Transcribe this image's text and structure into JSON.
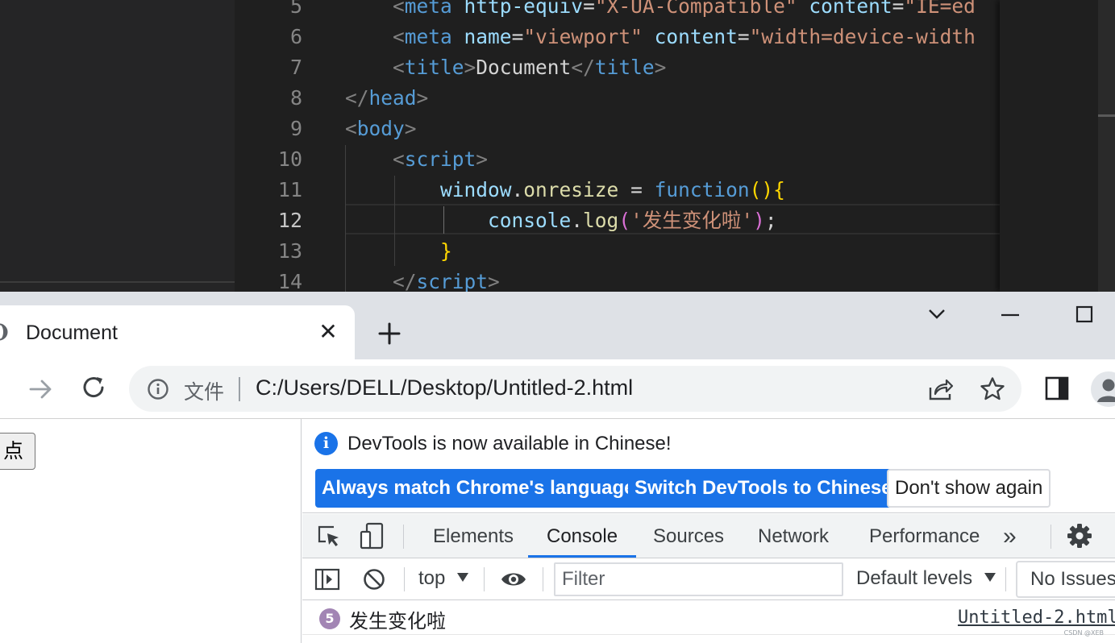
{
  "editor": {
    "line_numbers": [
      "5",
      "6",
      "7",
      "8",
      "9",
      "10",
      "11",
      "12",
      "13",
      "14"
    ],
    "active_line": "12",
    "lines": [
      [
        [
          "punc",
          "    <"
        ],
        [
          "tag",
          "meta"
        ],
        [
          "text",
          " "
        ],
        [
          "attr",
          "http-equiv"
        ],
        [
          "text",
          "="
        ],
        [
          "str",
          "\"X-UA-Compatible\""
        ],
        [
          "text",
          " "
        ],
        [
          "attr",
          "content"
        ],
        [
          "text",
          "="
        ],
        [
          "str",
          "\"IE=ed"
        ]
      ],
      [
        [
          "punc",
          "    <"
        ],
        [
          "tag",
          "meta"
        ],
        [
          "text",
          " "
        ],
        [
          "attr",
          "name"
        ],
        [
          "text",
          "="
        ],
        [
          "str",
          "\"viewport\""
        ],
        [
          "text",
          " "
        ],
        [
          "attr",
          "content"
        ],
        [
          "text",
          "="
        ],
        [
          "str",
          "\"width=device-width"
        ]
      ],
      [
        [
          "punc",
          "    <"
        ],
        [
          "tag",
          "title"
        ],
        [
          "punc",
          ">"
        ],
        [
          "text",
          "Document"
        ],
        [
          "punc",
          "</"
        ],
        [
          "tag",
          "title"
        ],
        [
          "punc",
          ">"
        ]
      ],
      [
        [
          "punc",
          "</"
        ],
        [
          "tag",
          "head"
        ],
        [
          "punc",
          ">"
        ]
      ],
      [
        [
          "punc",
          "<"
        ],
        [
          "tag",
          "body"
        ],
        [
          "punc",
          ">"
        ]
      ],
      [
        [
          "punc",
          "    <"
        ],
        [
          "tag",
          "script"
        ],
        [
          "punc",
          ">"
        ]
      ],
      [
        [
          "text",
          "        "
        ],
        [
          "var",
          "window"
        ],
        [
          "text",
          "."
        ],
        [
          "fn",
          "onresize"
        ],
        [
          "text",
          " = "
        ],
        [
          "kw",
          "function"
        ],
        [
          "brace1",
          "()"
        ],
        [
          "brace1",
          "{"
        ]
      ],
      [
        [
          "text",
          "            "
        ],
        [
          "var",
          "console"
        ],
        [
          "text",
          "."
        ],
        [
          "fn",
          "log"
        ],
        [
          "brace2",
          "("
        ],
        [
          "str",
          "'发生变化啦'"
        ],
        [
          "brace2",
          ")"
        ],
        [
          "text",
          ";"
        ]
      ],
      [
        [
          "text",
          "        "
        ],
        [
          "brace1",
          "}"
        ]
      ],
      [
        [
          "punc",
          "    </"
        ],
        [
          "tag",
          "script"
        ],
        [
          "punc",
          ">"
        ]
      ]
    ]
  },
  "browser": {
    "tab_title": "Document",
    "tab_close": "✕",
    "address_chip": "文件",
    "url": "C:/Users/DELL/Desktop/Untitled-2.html"
  },
  "page": {
    "button_label": "点击"
  },
  "devtools": {
    "notice_text": "DevTools is now available in Chinese!",
    "btn_always_match": "Always match Chrome's language",
    "btn_switch": "Switch DevTools to Chinese",
    "btn_dont_show": "Don't show again",
    "tabs": [
      "Elements",
      "Console",
      "Sources",
      "Network",
      "Performance"
    ],
    "active_tab": "Console",
    "more_tabs": "»",
    "context": "top",
    "filter_placeholder": "Filter",
    "levels": "Default levels",
    "issues": "No Issues",
    "log": {
      "count": "5",
      "message": "发生变化啦",
      "source": "Untitled-2.html"
    }
  },
  "watermark": "CSDN @XEB",
  "colors": {
    "accent": "#1a73e8",
    "editor_bg": "#1f1f1f",
    "log_badge": "#a285b4"
  }
}
